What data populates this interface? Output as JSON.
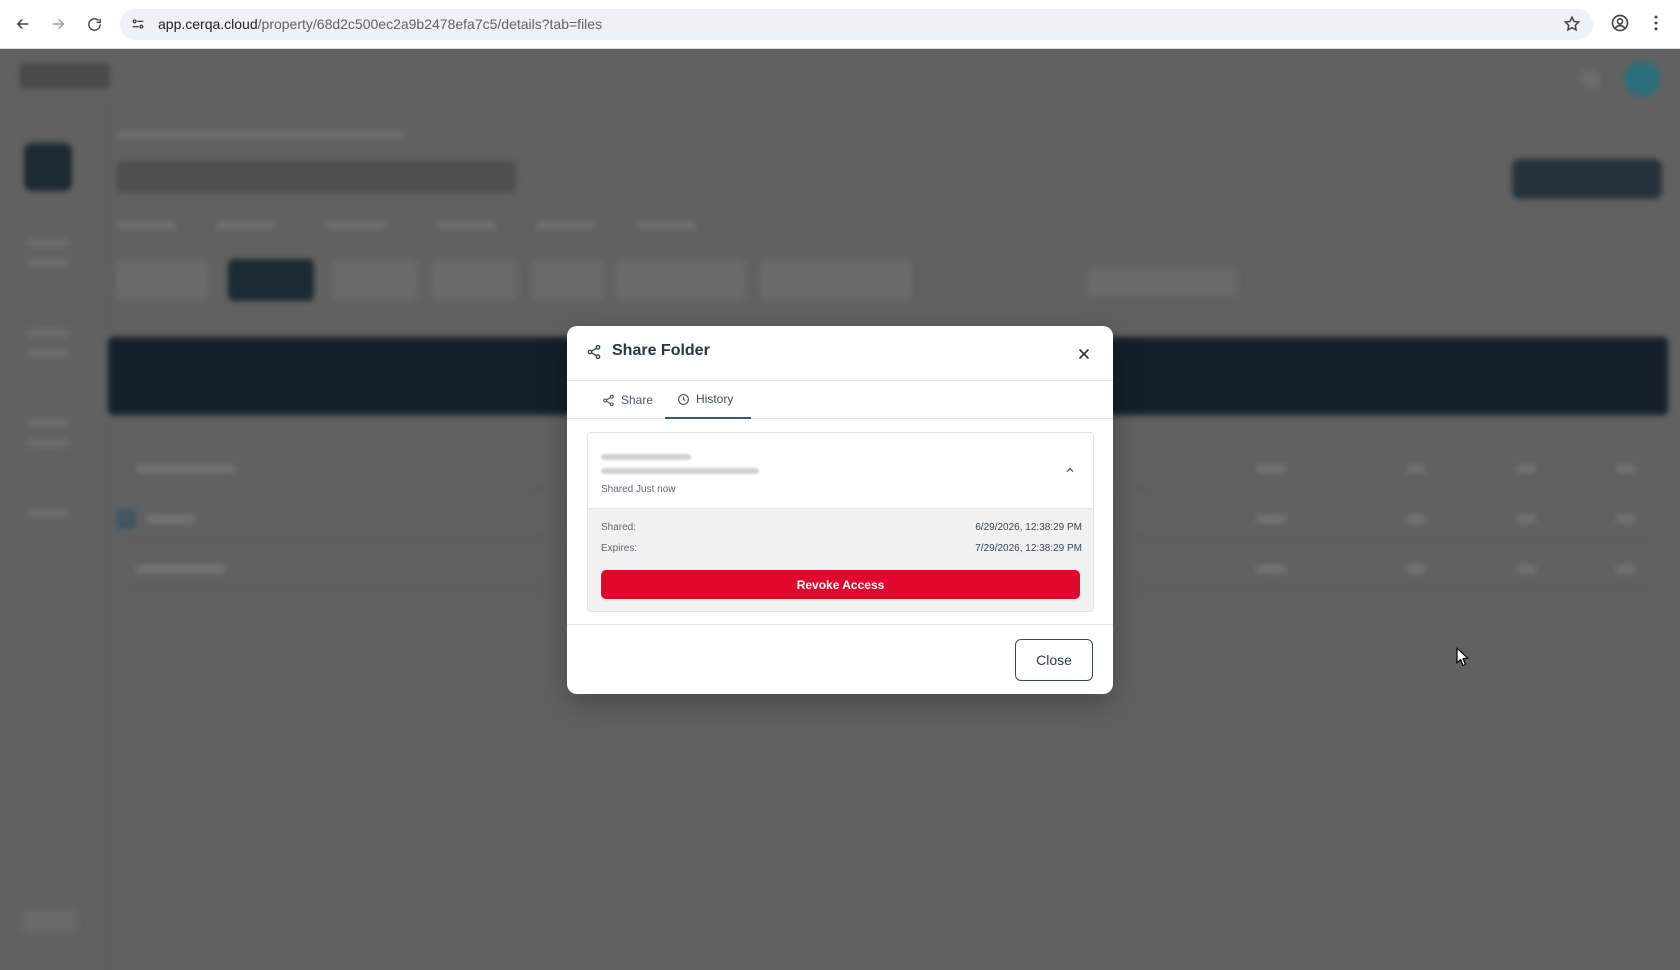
{
  "browser": {
    "url_host": "app.cerqa.cloud",
    "url_path": "/property/68d2c500ec2a9b2478efa7c5/details?tab=files"
  },
  "modal": {
    "title": "Share Folder",
    "tabs": [
      {
        "label": "Share",
        "icon": "share-icon",
        "active": false
      },
      {
        "label": "History",
        "icon": "clock-icon",
        "active": true
      }
    ],
    "history_entry": {
      "shared_when": "Shared Just now",
      "shared_label": "Shared:",
      "shared_value": "6/29/2026, 12:38:29 PM",
      "expires_label": "Expires:",
      "expires_value": "7/29/2026, 12:38:29 PM",
      "revoke_label": "Revoke Access"
    },
    "close_label": "Close"
  },
  "colors": {
    "revoke": "#e0082c",
    "overlay": "#5e5e5e",
    "title": "#263746"
  }
}
